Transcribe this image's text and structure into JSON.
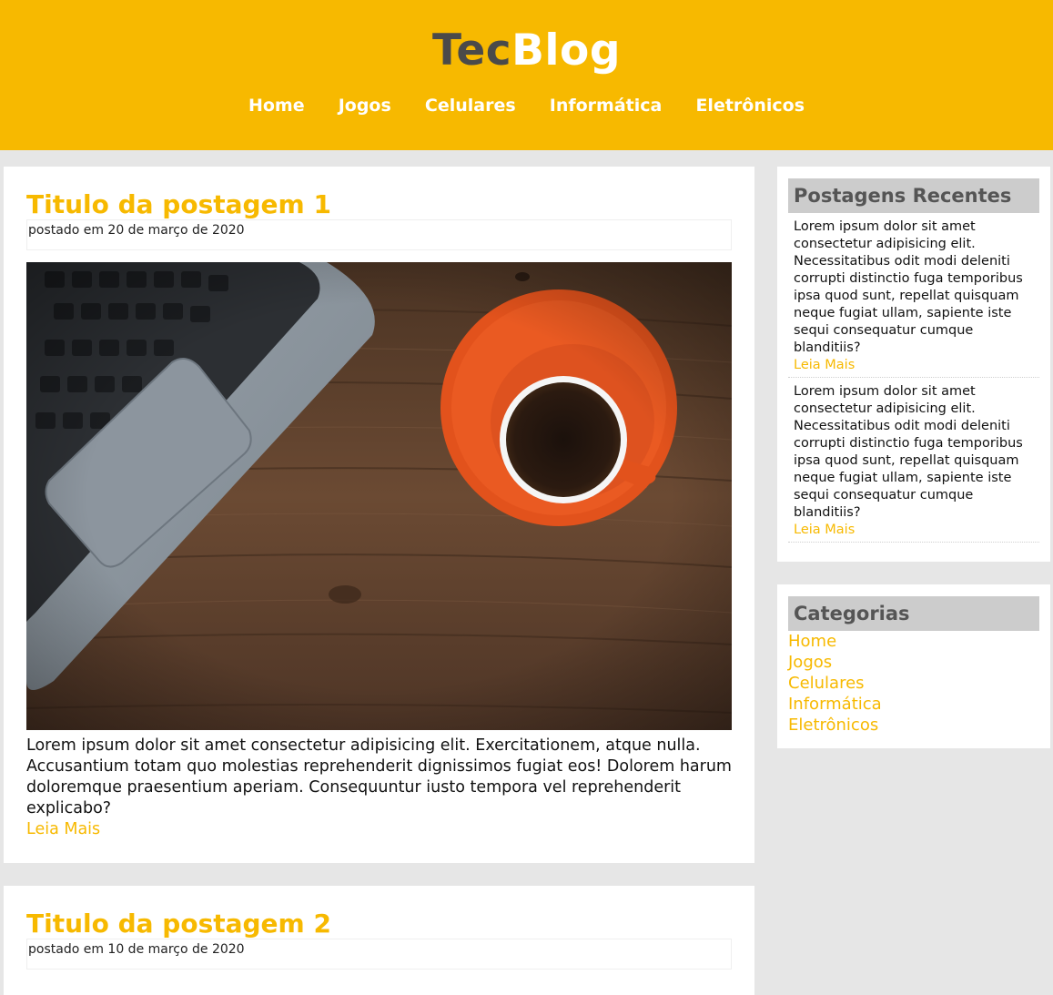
{
  "header": {
    "logo_part1": "Tec",
    "logo_part2": "Blog",
    "nav": [
      "Home",
      "Jogos",
      "Celulares",
      "Informática",
      "Eletrônicos"
    ]
  },
  "posts": [
    {
      "title": "Titulo da postagem 1",
      "meta": "postado em 20 de março de 2020",
      "text": "Lorem ipsum dolor sit amet consectetur adipisicing elit. Exercitationem, atque nulla. Accusantium totam quo molestias reprehenderit dignissimos fugiat eos! Dolorem harum doloremque praesentium aperiam. Consequuntur iusto tempora vel reprehenderit explicabo?",
      "more": "Leia Mais"
    },
    {
      "title": "Titulo da postagem 2",
      "meta": "postado em 10 de março de 2020"
    }
  ],
  "sidebar": {
    "recent_title": "Postagens Recentes",
    "recent": [
      {
        "text": "Lorem ipsum dolor sit amet consectetur adipisicing elit. Necessitatibus odit modi deleniti corrupti distinctio fuga temporibus ipsa quod sunt, repellat quisquam neque fugiat ullam, sapiente iste sequi consequatur cumque blanditiis?",
        "more": "Leia Mais"
      },
      {
        "text": "Lorem ipsum dolor sit amet consectetur adipisicing elit. Necessitatibus odit modi deleniti corrupti distinctio fuga temporibus ipsa quod sunt, repellat quisquam neque fugiat ullam, sapiente iste sequi consequatur cumque blanditiis?",
        "more": "Leia Mais"
      }
    ],
    "categories_title": "Categorias",
    "categories": [
      "Home",
      "Jogos",
      "Celulares",
      "Informática",
      "Eletrônicos"
    ]
  },
  "colors": {
    "accent": "#f7b900",
    "logo_dark": "#4a4a4a",
    "page_bg": "#e6e6e6",
    "sidebar_heading_bg": "#cccccc"
  },
  "image_alt": "laptop-and-coffee-cup-on-wooden-desk"
}
